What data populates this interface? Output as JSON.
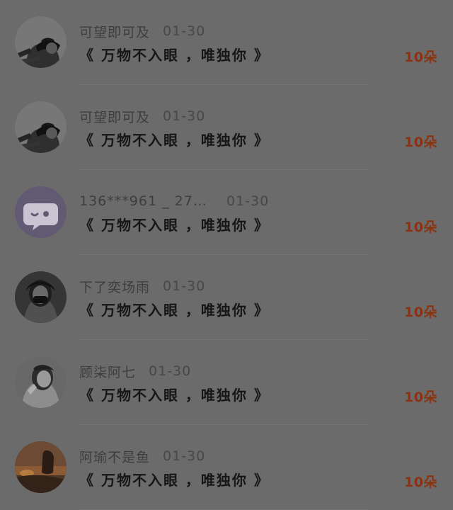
{
  "items": [
    {
      "name": "可望即可及",
      "date": "01-30",
      "message": "《 万物不入眼 ，唯独你 》",
      "count": "10朵",
      "avatar_icon": "cyclist-helmet-avatar"
    },
    {
      "name": "可望即可及",
      "date": "01-30",
      "message": "《 万物不入眼 ，唯独你 》",
      "count": "10朵",
      "avatar_icon": "cyclist-helmet-avatar"
    },
    {
      "name": "136***961 _ 272004…",
      "date": "01-30",
      "message": "《 万物不入眼 ，唯独你 》",
      "count": "10朵",
      "avatar_icon": "chat-bubble-avatar"
    },
    {
      "name": "下了奕场雨",
      "date": "01-30",
      "message": "《 万物不入眼 ，唯独你 》",
      "count": "10朵",
      "avatar_icon": "dark-portrait-avatar"
    },
    {
      "name": "顾柒阿七",
      "date": "01-30",
      "message": "《 万物不入眼 ，唯独你 》",
      "count": "10朵",
      "avatar_icon": "light-portrait-avatar"
    },
    {
      "name": "阿瑜不是鱼",
      "date": "01-30",
      "message": "《 万物不入眼 ，唯独你 》",
      "count": "10朵",
      "avatar_icon": "sunset-avatar"
    }
  ],
  "colors": {
    "overlay_background": "#6b6b6b",
    "count_text": "#8a3211",
    "message_text": "#161616"
  }
}
